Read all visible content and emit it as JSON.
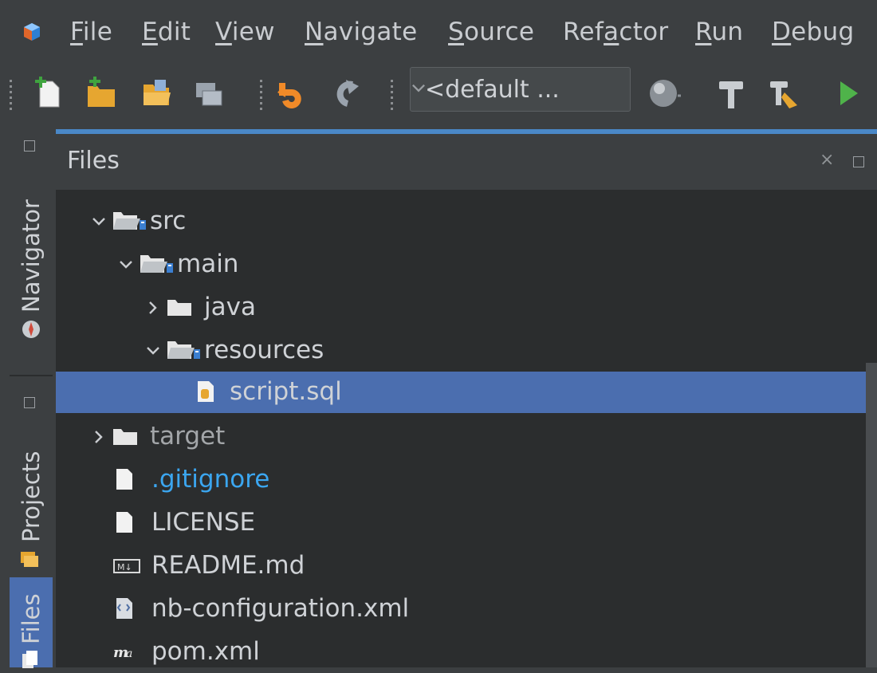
{
  "menubar": {
    "items": [
      {
        "pre": "",
        "key": "F",
        "post": "ile"
      },
      {
        "pre": "",
        "key": "E",
        "post": "dit"
      },
      {
        "pre": "",
        "key": "V",
        "post": "iew"
      },
      {
        "pre": "",
        "key": "N",
        "post": "avigate"
      },
      {
        "pre": "",
        "key": "S",
        "post": "ource"
      },
      {
        "pre": "Ref",
        "key": "a",
        "post": "ctor"
      },
      {
        "pre": "",
        "key": "R",
        "post": "un"
      },
      {
        "pre": "",
        "key": "D",
        "post": "ebug"
      }
    ]
  },
  "toolbar": {
    "config_value": "<default ...",
    "icons": [
      "new-file-icon",
      "new-project-icon",
      "open-project-icon",
      "close-project-icon",
      "undo-icon",
      "redo-icon",
      "globe-icon",
      "build-hammer-icon",
      "clean-build-icon",
      "run-icon"
    ]
  },
  "side": {
    "navigator_label": "Navigator",
    "projects_label": "Projects",
    "files_label": "Files"
  },
  "panel": {
    "title": "Files",
    "close_glyph": "×"
  },
  "tree": {
    "rows": [
      {
        "label": "src",
        "depth": 0,
        "expanded": true,
        "type": "source-folder"
      },
      {
        "label": "main",
        "depth": 1,
        "expanded": true,
        "type": "source-folder"
      },
      {
        "label": "java",
        "depth": 2,
        "expanded": false,
        "type": "folder"
      },
      {
        "label": "resources",
        "depth": 2,
        "expanded": true,
        "type": "source-folder"
      },
      {
        "label": "script.sql",
        "depth": 3,
        "type": "sql-file",
        "selected": true
      },
      {
        "label": "target",
        "depth": 0,
        "expanded": false,
        "type": "folder",
        "dim": true
      },
      {
        "label": ".gitignore",
        "depth": 0,
        "type": "file",
        "color": "#3ba6f0"
      },
      {
        "label": "LICENSE",
        "depth": 0,
        "type": "file"
      },
      {
        "label": "README.md",
        "depth": 0,
        "type": "markdown-file"
      },
      {
        "label": "nb-configuration.xml",
        "depth": 0,
        "type": "xml-file"
      },
      {
        "label": "pom.xml",
        "depth": 0,
        "type": "maven-file"
      }
    ]
  },
  "colors": {
    "selection": "#4b6eaf",
    "accent": "#4a88c7",
    "text": "#cfd2d6",
    "dim_text": "#a3a6a9",
    "git_ignored": "#3ba6f0"
  }
}
